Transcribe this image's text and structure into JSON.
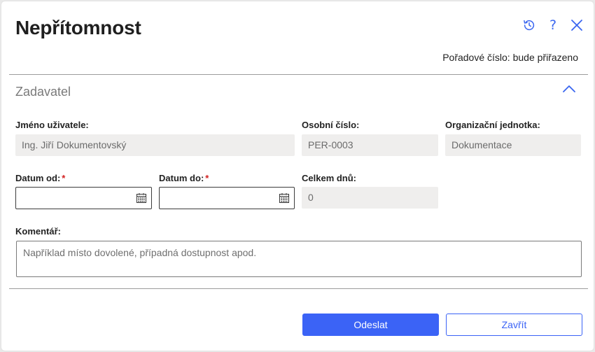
{
  "dialog": {
    "title": "Nepřítomnost",
    "order_number": "Pořadové číslo: bude přiřazeno",
    "icons": [
      "history-icon",
      "help-icon",
      "close-icon"
    ],
    "help_glyph": "?"
  },
  "section": {
    "title": "Zadavatel"
  },
  "fields": {
    "user_name": {
      "label": "Jméno uživatele:",
      "value": "Ing. Jiří Dokumentovský"
    },
    "personal_number": {
      "label": "Osobní číslo:",
      "value": "PER-0003"
    },
    "org_unit": {
      "label": "Organizační jednotka:",
      "value": "Dokumentace"
    },
    "date_from": {
      "label": "Datum od:",
      "value": "",
      "required_mark": "*"
    },
    "date_to": {
      "label": "Datum do:",
      "value": "",
      "required_mark": "*"
    },
    "total_days": {
      "label": "Celkem dnů:",
      "value": "0"
    },
    "comment": {
      "label": "Komentář:",
      "placeholder": "Například místo dovolené, případná dostupnost apod."
    }
  },
  "buttons": {
    "submit": "Odeslat",
    "close": "Zavřít"
  },
  "colors": {
    "accent": "#3b63f6",
    "required": "#d21f1f",
    "readonly_bg": "#efeeed"
  }
}
